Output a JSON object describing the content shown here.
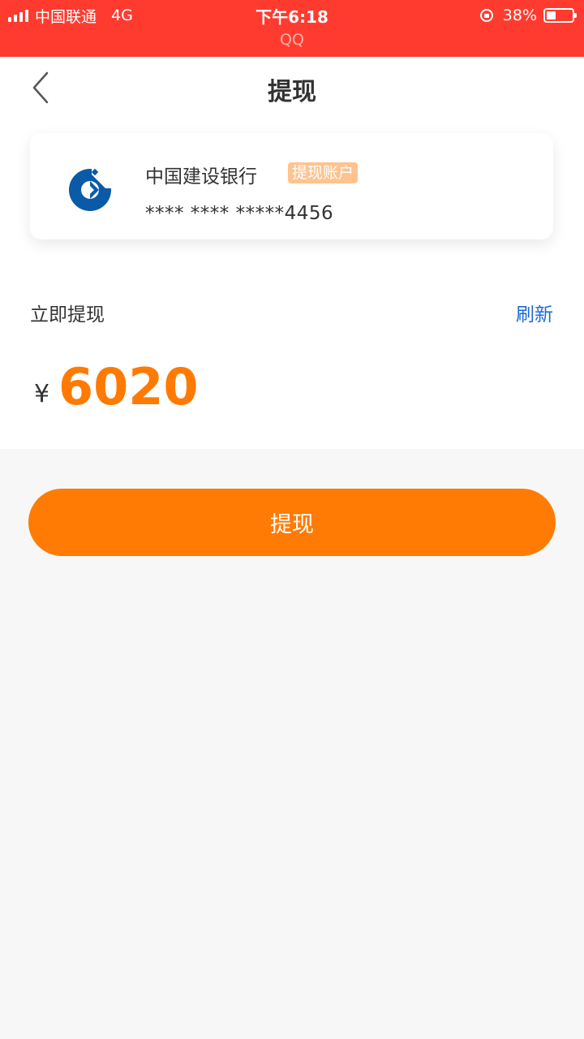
{
  "status_bar": {
    "carrier": "中国联通",
    "network": "4G",
    "time": "下午6:18",
    "app": "QQ",
    "battery_text": "38%",
    "battery_level": 0.38
  },
  "header": {
    "title": "提现",
    "back_icon": "chevron-left-icon"
  },
  "bank_card": {
    "bank_name": "中国建设银行",
    "badge": "提现账户",
    "card_number": "**** **** *****4456",
    "logo_icon": "ccb-bank-logo-icon",
    "logo_color": "#0a5aa8"
  },
  "withdraw": {
    "label": "立即提现",
    "refresh": "刷新",
    "currency": "¥",
    "amount": "6020"
  },
  "action_button": {
    "label": "提现"
  },
  "colors": {
    "status_bar": "#ff3b30",
    "accent": "#ff7b03",
    "link": "#1c6ad6",
    "badge": "#ffc38f"
  }
}
